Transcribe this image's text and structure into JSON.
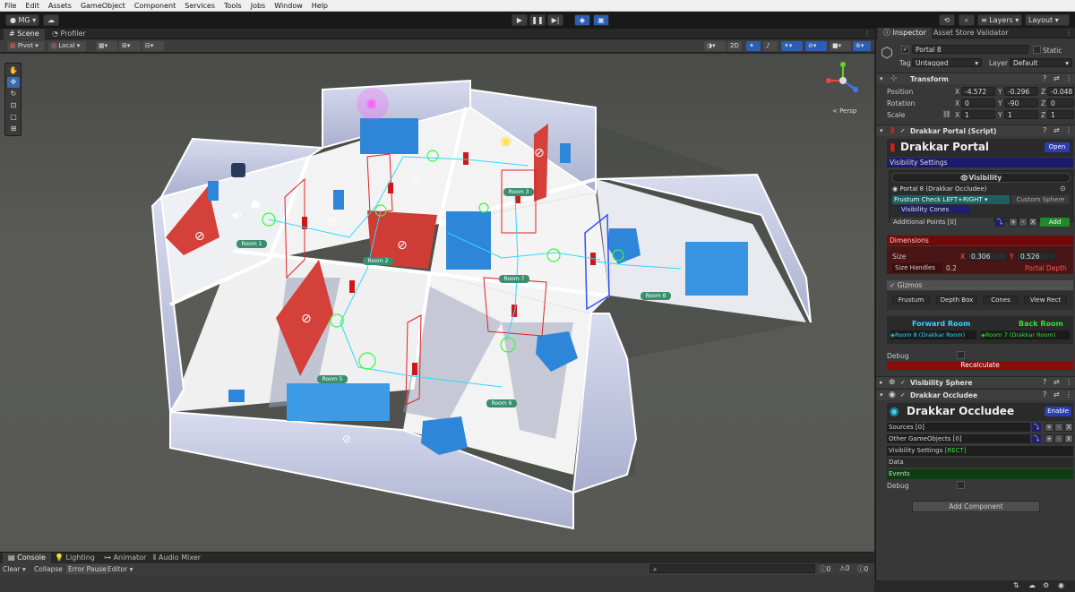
{
  "menu": [
    "File",
    "Edit",
    "Assets",
    "GameObject",
    "Component",
    "Services",
    "Tools",
    "Jobs",
    "Window",
    "Help"
  ],
  "toolbar": {
    "account": "MG",
    "layers": "Layers",
    "layout": "Layout"
  },
  "left_tabs": {
    "scene": "Scene",
    "profiler": "Profiler"
  },
  "scene_toolbar": {
    "pivot": "Pivot",
    "local": "Local",
    "mode_2d": "2D",
    "persp": "< Persp"
  },
  "scene_labels": {
    "room1": "Room 1",
    "room2": "Room 2",
    "room3": "Room 3",
    "room5": "Room 5",
    "room6": "Room 6",
    "room7": "Room 7",
    "room8": "Room 8"
  },
  "right_tabs": {
    "inspector": "Inspector",
    "asset_store": "Asset Store Validator"
  },
  "object": {
    "name": "Portal 8",
    "static_label": "Static",
    "tag_label": "Tag",
    "tag": "Untagged",
    "layer_label": "Layer",
    "layer": "Default"
  },
  "transform": {
    "title": "Transform",
    "position_label": "Position",
    "rotation_label": "Rotation",
    "scale_label": "Scale",
    "axis_x": "X",
    "axis_y": "Y",
    "axis_z": "Z",
    "position": {
      "x": "-4.572",
      "y": "-0.296",
      "z": "-0.048"
    },
    "rotation": {
      "x": "0",
      "y": "-90",
      "z": "0"
    },
    "scale": {
      "x": "1",
      "y": "1",
      "z": "1"
    }
  },
  "portal_script": {
    "title": "Drakkar Portal (Script)",
    "banner": "Drakkar Portal",
    "open_button": "Open",
    "visibility_settings": "Visibility Settings",
    "visibility_header": "Visibility",
    "occludee_ref": "Portal 8 (Drakkar Occludee)",
    "frustum_check": "Frustum Check LEFT+RIGHT",
    "custom_sphere": "Custom Sphere",
    "visibility_cones": "Visibility Cones",
    "additional_points": "Additional Points [0]",
    "add_button": "Add",
    "dimensions": "Dimensions",
    "size_label": "Size",
    "size_x": "0.306",
    "size_y": "0.526",
    "size_handles_label": "Size Handles",
    "size_handles": "0.2",
    "portal_depth": "Portal Depth",
    "gizmos": "Gizmos",
    "gizmo_buttons": [
      "Frustum",
      "Depth Box",
      "Cones",
      "View Rect"
    ],
    "forward_room_label": "Forward Room",
    "back_room_label": "Back Room",
    "forward_room": "Room 8 (Drakkar Room)",
    "back_room": "Room 7 (Drakkar Room)",
    "debug": "Debug",
    "recalculate": "Recalculate"
  },
  "visibility_sphere": {
    "title": "Visibility Sphere"
  },
  "occludee": {
    "title": "Drakkar Occludee",
    "banner": "Drakkar Occludee",
    "enable_button": "Enable",
    "sources": "Sources [0]",
    "other_gameobjects": "Other GameObjects [0]",
    "visibility_settings": "Visibility Settings",
    "rect_tag": "[RECT]",
    "data": "Data",
    "events": "Events",
    "debug": "Debug"
  },
  "add_component": "Add Component",
  "console": {
    "tabs": [
      "Console",
      "Lighting",
      "Animator",
      "Audio Mixer"
    ],
    "clear": "Clear",
    "collapse": "Collapse",
    "error_pause": "Error Pause",
    "editor": "Editor",
    "count_info": "0",
    "count_warn": "0",
    "count_err": "0"
  },
  "colors": {
    "accent_blue": "#2b5fb4",
    "header_blue": "#1c1c6e",
    "dimension_red": "#6e0a0a",
    "green": "#1e8a2a",
    "cyan_text": "#2fd8ff",
    "room_floor": "#f2f2f2",
    "wall": "#c9cfe6",
    "red_wall": "#d4403a",
    "furniture": "#2e86d8"
  }
}
